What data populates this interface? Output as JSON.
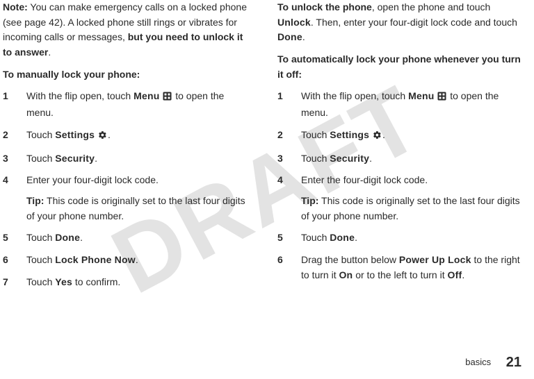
{
  "watermark": "DRAFT",
  "left": {
    "note_label": "Note:",
    "note_body_a": " You can make emergency calls on a locked phone (see page 42). A locked phone still rings or vibrates for incoming calls or messages, ",
    "note_body_b": "but you need to unlock it to answer",
    "note_body_c": ".",
    "manual_heading": "To manually lock your phone:",
    "s1_a": "With the flip open, touch ",
    "s1_menu": "Menu",
    "s1_b": " to open the menu.",
    "s2_a": "Touch ",
    "s2_settings": "Settings",
    "s2_b": ".",
    "s3_a": "Touch ",
    "s3_security": "Security",
    "s3_b": ".",
    "s4": "Enter your four-digit lock code.",
    "s4_tip_label": "Tip:",
    "s4_tip_body": " This code is originally set to the last four digits of your phone number.",
    "s5_a": "Touch ",
    "s5_done": "Done",
    "s5_b": ".",
    "s6_a": "Touch ",
    "s6_lockphone": "Lock Phone Now",
    "s6_b": ".",
    "s7_a": "Touch ",
    "s7_yes": "Yes",
    "s7_b": " to confirm.",
    "n1": "1",
    "n2": "2",
    "n3": "3",
    "n4": "4",
    "n5": "5",
    "n6": "6",
    "n7": "7"
  },
  "right": {
    "unlock_heading": "To unlock the phone",
    "unlock_a": ", open the phone and touch ",
    "unlock_unlock": "Unlock",
    "unlock_b": ". Then, enter your four-digit lock code and touch ",
    "unlock_done": "Done",
    "unlock_c": ".",
    "auto_heading": "To automatically lock your phone whenever you turn it off:",
    "s1_a": "With the flip open, touch ",
    "s1_menu": "Menu",
    "s1_b": " to open the menu.",
    "s2_a": "Touch ",
    "s2_settings": "Settings",
    "s2_b": ".",
    "s3_a": "Touch ",
    "s3_security": "Security",
    "s3_b": ".",
    "s4": "Enter the four-digit lock code.",
    "s4_tip_label": "Tip:",
    "s4_tip_body": " This code is originally set to the last four digits of your phone number.",
    "s5_a": "Touch ",
    "s5_done": "Done",
    "s5_b": ".",
    "s6_a": "Drag the button below ",
    "s6_powerup": "Power Up Lock",
    "s6_b": " to the right to turn it ",
    "s6_on": "On",
    "s6_c": " or to the left to turn it ",
    "s6_off": "Off",
    "s6_d": ".",
    "n1": "1",
    "n2": "2",
    "n3": "3",
    "n4": "4",
    "n5": "5",
    "n6": "6"
  },
  "footer": {
    "section": "basics",
    "page": "21"
  }
}
